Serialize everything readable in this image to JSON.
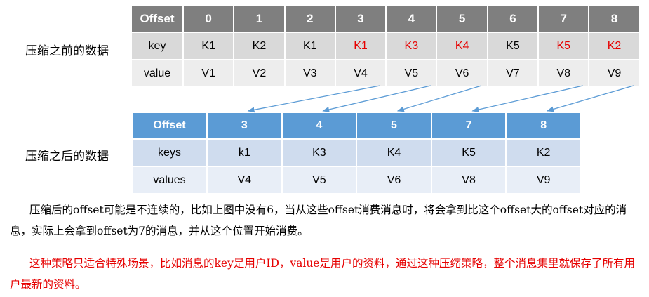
{
  "before": {
    "label": "压缩之前的数据",
    "header_label": "Offset",
    "offsets": [
      "0",
      "1",
      "2",
      "3",
      "4",
      "5",
      "6",
      "7",
      "8"
    ],
    "key_label": "key",
    "keys": [
      "K1",
      "K2",
      "K1",
      "K1",
      "K3",
      "K4",
      "K5",
      "K5",
      "K2"
    ],
    "red_key_indices": [
      3,
      4,
      5,
      7,
      8
    ],
    "value_label": "value",
    "values": [
      "V1",
      "V2",
      "V3",
      "V4",
      "V5",
      "V6",
      "V7",
      "V8",
      "V9"
    ]
  },
  "after": {
    "label": "压缩之后的数据",
    "header_label": "Offset",
    "offsets": [
      "3",
      "4",
      "5",
      "7",
      "8"
    ],
    "key_label": "keys",
    "keys": [
      "k1",
      "K3",
      "K4",
      "K5",
      "K2"
    ],
    "value_label": "values",
    "values": [
      "V4",
      "V5",
      "V6",
      "V8",
      "V9"
    ]
  },
  "arrows": [
    [
      3,
      0
    ],
    [
      4,
      1
    ],
    [
      5,
      2
    ],
    [
      7,
      3
    ],
    [
      8,
      4
    ]
  ],
  "colors": {
    "header_before": "#7f7f7f",
    "header_after": "#5b9bd5",
    "highlight": "#e60000",
    "arrow": "#5b9bd5"
  },
  "text": {
    "paragraph1": "压缩后的offset可能是不连续的，比如上图中没有6，当从这些offset消费消息时，将会拿到比这个offset大的offset对应的消息，实际上会拿到offset为7的消息，并从这个位置开始消费。",
    "paragraph2": "这种策略只适合特殊场景，比如消息的key是用户ID，value是用户的资料，通过这种压缩策略，整个消息集里就保存了所有用户最新的资料。"
  }
}
